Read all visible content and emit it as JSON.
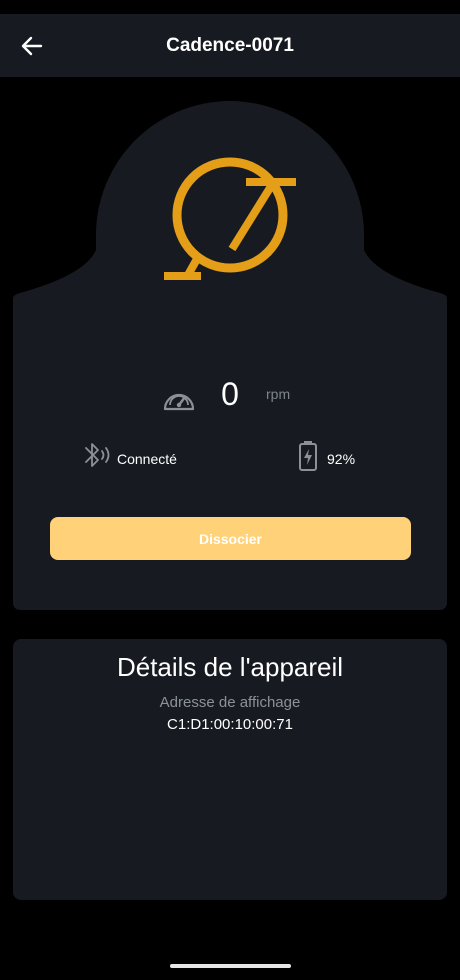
{
  "header": {
    "title": "Cadence-0071",
    "back_icon": "arrow-left-icon"
  },
  "device": {
    "logo_icon": "cadence-sensor-logo",
    "accent_color": "#e59e17",
    "speed": {
      "icon": "speedometer-icon",
      "value": "0",
      "unit": "rpm"
    },
    "connection": {
      "icon": "bluetooth-icon",
      "label": "Connecté"
    },
    "battery": {
      "icon": "battery-charging-icon",
      "label": "92%"
    },
    "dissociate_label": "Dissocier",
    "button_color": "#ffd27a"
  },
  "details": {
    "title": "Détails de l'appareil",
    "address_label": "Adresse de affichage",
    "address_value": "C1:D1:00:10:00:71"
  }
}
